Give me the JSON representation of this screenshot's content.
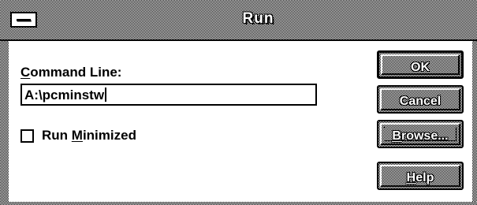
{
  "window": {
    "title": "Run"
  },
  "form": {
    "command_label_mnemonic": "C",
    "command_label_rest": "ommand Line:",
    "command_value": "A:\\pcminstw",
    "run_minimized_checked": false,
    "run_minimized_prefix": "Run ",
    "run_minimized_mnemonic": "M",
    "run_minimized_rest": "inimized"
  },
  "buttons": {
    "ok": "OK",
    "cancel": "Cancel",
    "browse_mnemonic": "B",
    "browse_rest": "rowse...",
    "help_mnemonic": "H",
    "help_rest": "elp"
  }
}
